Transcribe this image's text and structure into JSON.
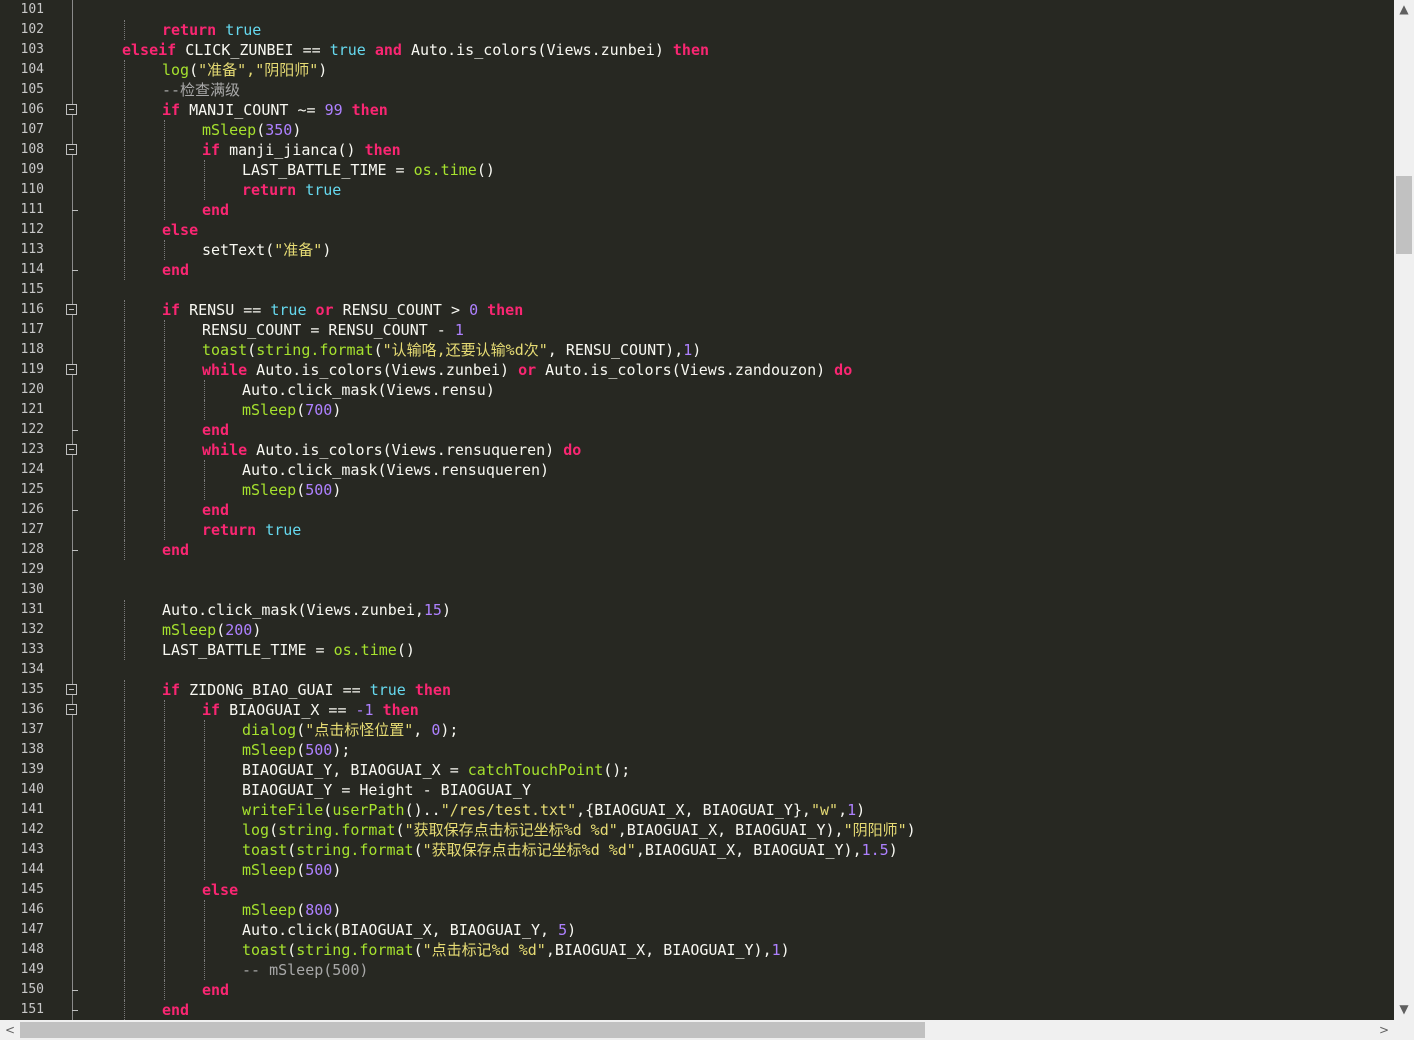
{
  "editor": {
    "first_line_number": 101,
    "lines": [
      {
        "n": "101",
        "indent": 0,
        "tokens": []
      },
      {
        "n": "102",
        "indent": 2,
        "tokens": [
          {
            "t": "kw",
            "v": "return"
          },
          {
            "t": "op",
            "v": " "
          },
          {
            "t": "lit",
            "v": "true"
          }
        ]
      },
      {
        "n": "103",
        "indent": 1,
        "tokens": [
          {
            "t": "kw",
            "v": "elseif"
          },
          {
            "t": "op",
            "v": " CLICK_ZUNBEI == "
          },
          {
            "t": "lit",
            "v": "true"
          },
          {
            "t": "op",
            "v": " "
          },
          {
            "t": "kw",
            "v": "and"
          },
          {
            "t": "op",
            "v": " Auto.is_colors(Views.zunbei) "
          },
          {
            "t": "kw",
            "v": "then"
          }
        ]
      },
      {
        "n": "104",
        "indent": 2,
        "tokens": [
          {
            "t": "fn",
            "v": "log"
          },
          {
            "t": "op",
            "v": "("
          },
          {
            "t": "str",
            "v": "\"准备\",\"阴阳师\""
          },
          {
            "t": "op",
            "v": ")"
          }
        ]
      },
      {
        "n": "105",
        "indent": 2,
        "tokens": [
          {
            "t": "cm",
            "v": "--检查满级"
          }
        ]
      },
      {
        "n": "106",
        "indent": 2,
        "tokens": [
          {
            "t": "kw",
            "v": "if"
          },
          {
            "t": "op",
            "v": " MANJI_COUNT ~= "
          },
          {
            "t": "num",
            "v": "99"
          },
          {
            "t": "op",
            "v": " "
          },
          {
            "t": "kw",
            "v": "then"
          }
        ]
      },
      {
        "n": "107",
        "indent": 3,
        "tokens": [
          {
            "t": "fn",
            "v": "mSleep"
          },
          {
            "t": "op",
            "v": "("
          },
          {
            "t": "num",
            "v": "350"
          },
          {
            "t": "op",
            "v": ")"
          }
        ]
      },
      {
        "n": "108",
        "indent": 3,
        "tokens": [
          {
            "t": "kw",
            "v": "if"
          },
          {
            "t": "op",
            "v": " manji_jianca() "
          },
          {
            "t": "kw",
            "v": "then"
          }
        ]
      },
      {
        "n": "109",
        "indent": 4,
        "tokens": [
          {
            "t": "op",
            "v": "LAST_BATTLE_TIME = "
          },
          {
            "t": "fn",
            "v": "os.time"
          },
          {
            "t": "op",
            "v": "()"
          }
        ]
      },
      {
        "n": "110",
        "indent": 4,
        "tokens": [
          {
            "t": "kw",
            "v": "return"
          },
          {
            "t": "op",
            "v": " "
          },
          {
            "t": "lit",
            "v": "true"
          }
        ]
      },
      {
        "n": "111",
        "indent": 3,
        "tokens": [
          {
            "t": "kw",
            "v": "end"
          }
        ]
      },
      {
        "n": "112",
        "indent": 2,
        "tokens": [
          {
            "t": "kw",
            "v": "else"
          }
        ]
      },
      {
        "n": "113",
        "indent": 3,
        "tokens": [
          {
            "t": "op",
            "v": "setText("
          },
          {
            "t": "str",
            "v": "\"准备\""
          },
          {
            "t": "op",
            "v": ")"
          }
        ]
      },
      {
        "n": "114",
        "indent": 2,
        "tokens": [
          {
            "t": "kw",
            "v": "end"
          }
        ]
      },
      {
        "n": "115",
        "indent": 0,
        "tokens": []
      },
      {
        "n": "116",
        "indent": 2,
        "tokens": [
          {
            "t": "kw",
            "v": "if"
          },
          {
            "t": "op",
            "v": " RENSU == "
          },
          {
            "t": "lit",
            "v": "true"
          },
          {
            "t": "op",
            "v": " "
          },
          {
            "t": "kw",
            "v": "or"
          },
          {
            "t": "op",
            "v": " RENSU_COUNT > "
          },
          {
            "t": "num",
            "v": "0"
          },
          {
            "t": "op",
            "v": " "
          },
          {
            "t": "kw",
            "v": "then"
          }
        ]
      },
      {
        "n": "117",
        "indent": 3,
        "tokens": [
          {
            "t": "op",
            "v": "RENSU_COUNT = RENSU_COUNT - "
          },
          {
            "t": "num",
            "v": "1"
          }
        ]
      },
      {
        "n": "118",
        "indent": 3,
        "tokens": [
          {
            "t": "fn",
            "v": "toast"
          },
          {
            "t": "op",
            "v": "("
          },
          {
            "t": "fn",
            "v": "string.format"
          },
          {
            "t": "op",
            "v": "("
          },
          {
            "t": "str",
            "v": "\"认输咯,还要认输%d次\""
          },
          {
            "t": "op",
            "v": ", RENSU_COUNT),"
          },
          {
            "t": "num",
            "v": "1"
          },
          {
            "t": "op",
            "v": ")"
          }
        ]
      },
      {
        "n": "119",
        "indent": 3,
        "tokens": [
          {
            "t": "kw",
            "v": "while"
          },
          {
            "t": "op",
            "v": " Auto.is_colors(Views.zunbei) "
          },
          {
            "t": "kw",
            "v": "or"
          },
          {
            "t": "op",
            "v": " Auto.is_colors(Views.zandouzon) "
          },
          {
            "t": "kw",
            "v": "do"
          }
        ]
      },
      {
        "n": "120",
        "indent": 4,
        "tokens": [
          {
            "t": "op",
            "v": "Auto.click_mask(Views.rensu)"
          }
        ]
      },
      {
        "n": "121",
        "indent": 4,
        "tokens": [
          {
            "t": "fn",
            "v": "mSleep"
          },
          {
            "t": "op",
            "v": "("
          },
          {
            "t": "num",
            "v": "700"
          },
          {
            "t": "op",
            "v": ")"
          }
        ]
      },
      {
        "n": "122",
        "indent": 3,
        "tokens": [
          {
            "t": "kw",
            "v": "end"
          }
        ]
      },
      {
        "n": "123",
        "indent": 3,
        "tokens": [
          {
            "t": "kw",
            "v": "while"
          },
          {
            "t": "op",
            "v": " Auto.is_colors(Views.rensuqueren) "
          },
          {
            "t": "kw",
            "v": "do"
          }
        ]
      },
      {
        "n": "124",
        "indent": 4,
        "tokens": [
          {
            "t": "op",
            "v": "Auto.click_mask(Views.rensuqueren)"
          }
        ]
      },
      {
        "n": "125",
        "indent": 4,
        "tokens": [
          {
            "t": "fn",
            "v": "mSleep"
          },
          {
            "t": "op",
            "v": "("
          },
          {
            "t": "num",
            "v": "500"
          },
          {
            "t": "op",
            "v": ")"
          }
        ]
      },
      {
        "n": "126",
        "indent": 3,
        "tokens": [
          {
            "t": "kw",
            "v": "end"
          }
        ]
      },
      {
        "n": "127",
        "indent": 3,
        "tokens": [
          {
            "t": "kw",
            "v": "return"
          },
          {
            "t": "op",
            "v": " "
          },
          {
            "t": "lit",
            "v": "true"
          }
        ]
      },
      {
        "n": "128",
        "indent": 2,
        "tokens": [
          {
            "t": "kw",
            "v": "end"
          }
        ]
      },
      {
        "n": "129",
        "indent": 0,
        "tokens": []
      },
      {
        "n": "130",
        "indent": 0,
        "tokens": []
      },
      {
        "n": "131",
        "indent": 2,
        "tokens": [
          {
            "t": "op",
            "v": "Auto.click_mask(Views.zunbei,"
          },
          {
            "t": "num",
            "v": "15"
          },
          {
            "t": "op",
            "v": ")"
          }
        ]
      },
      {
        "n": "132",
        "indent": 2,
        "tokens": [
          {
            "t": "fn",
            "v": "mSleep"
          },
          {
            "t": "op",
            "v": "("
          },
          {
            "t": "num",
            "v": "200"
          },
          {
            "t": "op",
            "v": ")"
          }
        ]
      },
      {
        "n": "133",
        "indent": 2,
        "tokens": [
          {
            "t": "op",
            "v": "LAST_BATTLE_TIME = "
          },
          {
            "t": "fn",
            "v": "os.time"
          },
          {
            "t": "op",
            "v": "()"
          }
        ]
      },
      {
        "n": "134",
        "indent": 0,
        "tokens": []
      },
      {
        "n": "135",
        "indent": 2,
        "tokens": [
          {
            "t": "kw",
            "v": "if"
          },
          {
            "t": "op",
            "v": " ZIDONG_BIAO_GUAI == "
          },
          {
            "t": "lit",
            "v": "true"
          },
          {
            "t": "op",
            "v": " "
          },
          {
            "t": "kw",
            "v": "then"
          }
        ]
      },
      {
        "n": "136",
        "indent": 3,
        "tokens": [
          {
            "t": "kw",
            "v": "if"
          },
          {
            "t": "op",
            "v": " BIAOGUAI_X == "
          },
          {
            "t": "num",
            "v": "-1"
          },
          {
            "t": "op",
            "v": " "
          },
          {
            "t": "kw",
            "v": "then"
          }
        ]
      },
      {
        "n": "137",
        "indent": 4,
        "tokens": [
          {
            "t": "fn",
            "v": "dialog"
          },
          {
            "t": "op",
            "v": "("
          },
          {
            "t": "str",
            "v": "\"点击标怪位置\""
          },
          {
            "t": "op",
            "v": ", "
          },
          {
            "t": "num",
            "v": "0"
          },
          {
            "t": "op",
            "v": ");"
          }
        ]
      },
      {
        "n": "138",
        "indent": 4,
        "tokens": [
          {
            "t": "fn",
            "v": "mSleep"
          },
          {
            "t": "op",
            "v": "("
          },
          {
            "t": "num",
            "v": "500"
          },
          {
            "t": "op",
            "v": ");"
          }
        ]
      },
      {
        "n": "139",
        "indent": 4,
        "tokens": [
          {
            "t": "op",
            "v": "BIAOGUAI_Y, BIAOGUAI_X = "
          },
          {
            "t": "fn",
            "v": "catchTouchPoint"
          },
          {
            "t": "op",
            "v": "();"
          }
        ]
      },
      {
        "n": "140",
        "indent": 4,
        "tokens": [
          {
            "t": "op",
            "v": "BIAOGUAI_Y = Height - BIAOGUAI_Y"
          }
        ]
      },
      {
        "n": "141",
        "indent": 4,
        "tokens": [
          {
            "t": "fn",
            "v": "writeFile"
          },
          {
            "t": "op",
            "v": "("
          },
          {
            "t": "fn",
            "v": "userPath"
          },
          {
            "t": "op",
            "v": "().."
          },
          {
            "t": "str",
            "v": "\"/res/test.txt\""
          },
          {
            "t": "op",
            "v": ",{BIAOGUAI_X, BIAOGUAI_Y},"
          },
          {
            "t": "str",
            "v": "\"w\""
          },
          {
            "t": "op",
            "v": ","
          },
          {
            "t": "num",
            "v": "1"
          },
          {
            "t": "op",
            "v": ")"
          }
        ]
      },
      {
        "n": "142",
        "indent": 4,
        "tokens": [
          {
            "t": "fn",
            "v": "log"
          },
          {
            "t": "op",
            "v": "("
          },
          {
            "t": "fn",
            "v": "string.format"
          },
          {
            "t": "op",
            "v": "("
          },
          {
            "t": "str",
            "v": "\"获取保存点击标记坐标%d %d\""
          },
          {
            "t": "op",
            "v": ",BIAOGUAI_X, BIAOGUAI_Y),"
          },
          {
            "t": "str",
            "v": "\"阴阳师\""
          },
          {
            "t": "op",
            "v": ")"
          }
        ]
      },
      {
        "n": "143",
        "indent": 4,
        "tokens": [
          {
            "t": "fn",
            "v": "toast"
          },
          {
            "t": "op",
            "v": "("
          },
          {
            "t": "fn",
            "v": "string.format"
          },
          {
            "t": "op",
            "v": "("
          },
          {
            "t": "str",
            "v": "\"获取保存点击标记坐标%d %d\""
          },
          {
            "t": "op",
            "v": ",BIAOGUAI_X, BIAOGUAI_Y),"
          },
          {
            "t": "num",
            "v": "1.5"
          },
          {
            "t": "op",
            "v": ")"
          }
        ]
      },
      {
        "n": "144",
        "indent": 4,
        "tokens": [
          {
            "t": "fn",
            "v": "mSleep"
          },
          {
            "t": "op",
            "v": "("
          },
          {
            "t": "num",
            "v": "500"
          },
          {
            "t": "op",
            "v": ")"
          }
        ]
      },
      {
        "n": "145",
        "indent": 3,
        "tokens": [
          {
            "t": "kw",
            "v": "else"
          }
        ]
      },
      {
        "n": "146",
        "indent": 4,
        "tokens": [
          {
            "t": "fn",
            "v": "mSleep"
          },
          {
            "t": "op",
            "v": "("
          },
          {
            "t": "num",
            "v": "800"
          },
          {
            "t": "op",
            "v": ")"
          }
        ]
      },
      {
        "n": "147",
        "indent": 4,
        "tokens": [
          {
            "t": "op",
            "v": "Auto.click(BIAOGUAI_X, BIAOGUAI_Y, "
          },
          {
            "t": "num",
            "v": "5"
          },
          {
            "t": "op",
            "v": ")"
          }
        ]
      },
      {
        "n": "148",
        "indent": 4,
        "tokens": [
          {
            "t": "fn",
            "v": "toast"
          },
          {
            "t": "op",
            "v": "("
          },
          {
            "t": "fn",
            "v": "string.format"
          },
          {
            "t": "op",
            "v": "("
          },
          {
            "t": "str",
            "v": "\"点击标记%d %d\""
          },
          {
            "t": "op",
            "v": ",BIAOGUAI_X, BIAOGUAI_Y),"
          },
          {
            "t": "num",
            "v": "1"
          },
          {
            "t": "op",
            "v": ")"
          }
        ]
      },
      {
        "n": "149",
        "indent": 4,
        "tokens": [
          {
            "t": "cm",
            "v": "-- mSleep(500)"
          }
        ]
      },
      {
        "n": "150",
        "indent": 3,
        "tokens": [
          {
            "t": "kw",
            "v": "end"
          }
        ]
      },
      {
        "n": "151",
        "indent": 2,
        "tokens": [
          {
            "t": "kw",
            "v": "end"
          }
        ]
      }
    ],
    "fold_open_lines": [
      "106",
      "108",
      "116",
      "119",
      "123",
      "135",
      "136"
    ],
    "fold_end_lines": [
      "111",
      "114",
      "122",
      "126",
      "128",
      "150",
      "151"
    ]
  },
  "colors": {
    "background": "#272822",
    "keyword": "#f92672",
    "literal": "#66d9ef",
    "number": "#ae81ff",
    "string": "#e6db74",
    "function": "#a6e22e",
    "comment": "#a8a8a8",
    "text": "#f8f8f2"
  },
  "scrollbars": {
    "vertical": {
      "up_arrow": "▲",
      "down_arrow": "▼",
      "position": 0.17
    },
    "horizontal": {
      "left_arrow": "<",
      "right_arrow": ">",
      "position": 0.0
    }
  }
}
